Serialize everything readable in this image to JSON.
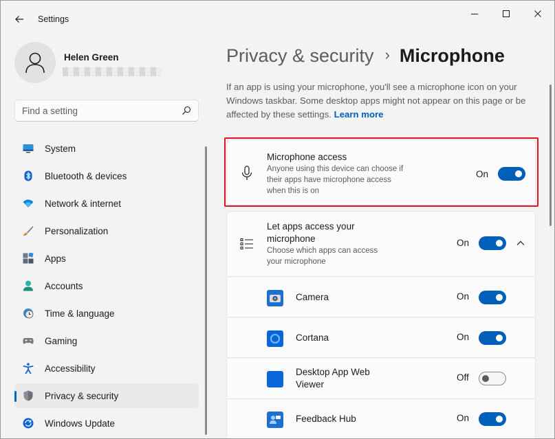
{
  "window": {
    "app_title": "Settings",
    "controls": {
      "minimize": "minimize-icon",
      "maximize": "maximize-icon",
      "close": "close-icon"
    }
  },
  "user": {
    "name": "Helen Green",
    "avatar_icon": "person-icon"
  },
  "search": {
    "placeholder": "Find a setting",
    "value": "",
    "icon": "search-icon"
  },
  "nav": {
    "items": [
      {
        "label": "System",
        "icon": "monitor-icon",
        "active": false
      },
      {
        "label": "Bluetooth & devices",
        "icon": "bluetooth-icon",
        "active": false
      },
      {
        "label": "Network & internet",
        "icon": "wifi-icon",
        "active": false
      },
      {
        "label": "Personalization",
        "icon": "brush-icon",
        "active": false
      },
      {
        "label": "Apps",
        "icon": "apps-icon",
        "active": false
      },
      {
        "label": "Accounts",
        "icon": "accounts-icon",
        "active": false
      },
      {
        "label": "Time & language",
        "icon": "globe-clock-icon",
        "active": false
      },
      {
        "label": "Gaming",
        "icon": "gamepad-icon",
        "active": false
      },
      {
        "label": "Accessibility",
        "icon": "accessibility-icon",
        "active": false
      },
      {
        "label": "Privacy & security",
        "icon": "shield-icon",
        "active": true
      },
      {
        "label": "Windows Update",
        "icon": "update-icon",
        "active": false
      }
    ]
  },
  "header": {
    "parent": "Privacy & security",
    "separator": "›",
    "current": "Microphone"
  },
  "intro": {
    "text": "If an app is using your microphone, you'll see a microphone icon on your Windows taskbar. Some desktop apps might not appear on this page or be affected by these settings.",
    "link": "Learn more"
  },
  "microphone_access": {
    "title": "Microphone access",
    "description": "Anyone using this device can choose if their apps have microphone access when this is on",
    "state": "On",
    "enabled": true,
    "icon": "microphone-icon"
  },
  "let_apps": {
    "title": "Let apps access your microphone",
    "description": "Choose which apps can access your microphone",
    "state": "On",
    "enabled": true,
    "icon": "list-icon",
    "expand_icon": "chevron-up-icon"
  },
  "apps": [
    {
      "name": "Camera",
      "state": "On",
      "enabled": true,
      "icon": "camera-app-icon"
    },
    {
      "name": "Cortana",
      "state": "On",
      "enabled": true,
      "icon": "cortana-app-icon"
    },
    {
      "name": "Desktop App Web Viewer",
      "state": "Off",
      "enabled": false,
      "icon": "webviewer-app-icon"
    },
    {
      "name": "Feedback Hub",
      "state": "On",
      "enabled": true,
      "icon": "feedback-hub-app-icon"
    }
  ],
  "colors": {
    "accent": "#005fb8",
    "highlight_border": "#e81123",
    "background": "#f3f3f3",
    "card": "#fbfbfb"
  }
}
